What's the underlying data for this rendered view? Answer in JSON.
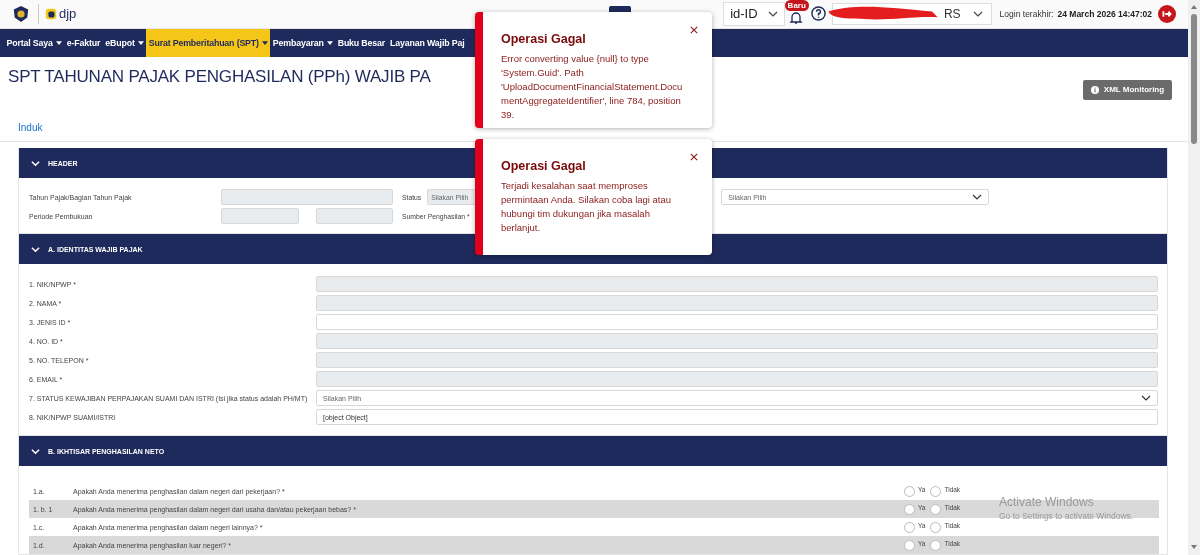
{
  "top_bar": {
    "logo_text": "djp",
    "language": "id-ID",
    "notification_badge": "Baru",
    "user_select_visible": "RS",
    "login_label": "Login terakhir:",
    "login_time": "24 March 2026 14:47:02"
  },
  "nav": [
    {
      "label": "Portal Saya",
      "dropdown": true,
      "selected": false
    },
    {
      "label": "e-Faktur",
      "dropdown": false,
      "selected": false
    },
    {
      "label": "eBupot",
      "dropdown": true,
      "selected": false
    },
    {
      "label": "Surat Pemberitahuan (SPT)",
      "dropdown": true,
      "selected": true
    },
    {
      "label": "Pembayaran",
      "dropdown": true,
      "selected": false
    },
    {
      "label": "Buku Besar",
      "dropdown": false,
      "selected": false
    },
    {
      "label": "Layanan Wajib Paj",
      "dropdown": false,
      "selected": false
    }
  ],
  "page_title": "SPT TAHUNAN PAJAK PENGHASILAN (PPh) WAJIB PA",
  "xml_button": "XML Monitoring",
  "tabs": [
    {
      "label": "Induk",
      "selected": true
    }
  ],
  "header_section": {
    "title": "HEADER",
    "expanded": true,
    "tax_year_label": "Tahun Pajak/Bagian Tahun Pajak",
    "status_label": "Status",
    "status_placeholder": "Silakan Pilih",
    "right_select_placeholder": "Silakan Pilih",
    "period_label": "Periode Pembukuan",
    "income_source_label": "Sumber Penghasilan *"
  },
  "identity_section": {
    "title": "A. IDENTITAS WAJIB PAJAK",
    "expanded": true,
    "rows": [
      {
        "label": "1. NIK/NPWP *",
        "kind": "readonly"
      },
      {
        "label": "2. NAMA *",
        "kind": "readonly"
      },
      {
        "label": "3. JENIS ID *",
        "kind": "text"
      },
      {
        "label": "4. NO. ID *",
        "kind": "readonly"
      },
      {
        "label": "5. NO. TELEPON *",
        "kind": "readonly"
      },
      {
        "label": "6. EMAIL *",
        "kind": "readonly"
      },
      {
        "label": "7. STATUS KEWAJIBAN PERPAJAKAN SUAMI DAN ISTRI (Isi jika status adalah PH/MT)",
        "kind": "select",
        "placeholder": "Silakan Pilih"
      },
      {
        "label": "8. NIK/NPWP SUAMI/ISTRI",
        "kind": "text",
        "value": "[object Object]"
      }
    ]
  },
  "income_section": {
    "title": "B. IKHTISAR PENGHASILAN NETO",
    "expanded": true,
    "rows": [
      {
        "number": "1.a.",
        "question": "Apakah Anda menerima penghasilan dalam negeri dari pekerjaan? *",
        "options": [
          {
            "label": "Ya",
            "selected": false
          },
          {
            "label": "Tidak",
            "selected": false
          }
        ]
      },
      {
        "number": "1. b. 1",
        "question": "Apakah Anda menerima penghasilan dalam negeri dari usaha dan/atau pekerjaan bebas? *",
        "options": [
          {
            "label": "Ya",
            "selected": false
          },
          {
            "label": "Tidak",
            "selected": false
          }
        ]
      },
      {
        "number": "1.c.",
        "question": "Apakah Anda menerima penghasilan dalam negeri lainnya? *",
        "options": [
          {
            "label": "Ya",
            "selected": false
          },
          {
            "label": "Tidak",
            "selected": false
          }
        ]
      },
      {
        "number": "1.d.",
        "question": "Apakah Anda menerima penghasilan luar negeri? *",
        "options": [
          {
            "label": "Ya",
            "selected": false
          },
          {
            "label": "Tidak",
            "selected": false
          }
        ]
      }
    ]
  },
  "toasts": [
    {
      "title": "Operasi Gagal",
      "message": "Error converting value {null} to type 'System.Guid'. Path 'UploadDocumentFinancialStatement.DocumentAggregateIdentifier', line 784, position 39."
    },
    {
      "title": "Operasi Gagal",
      "message": "Terjadi kesalahan saat memproses permintaan Anda. Silakan coba lagi atau hubungi tim dukungan jika masalah berlanjut."
    }
  ],
  "os_notice": {
    "title": "Activate Windows",
    "subtitle": "Go to Settings to activate Windows."
  }
}
